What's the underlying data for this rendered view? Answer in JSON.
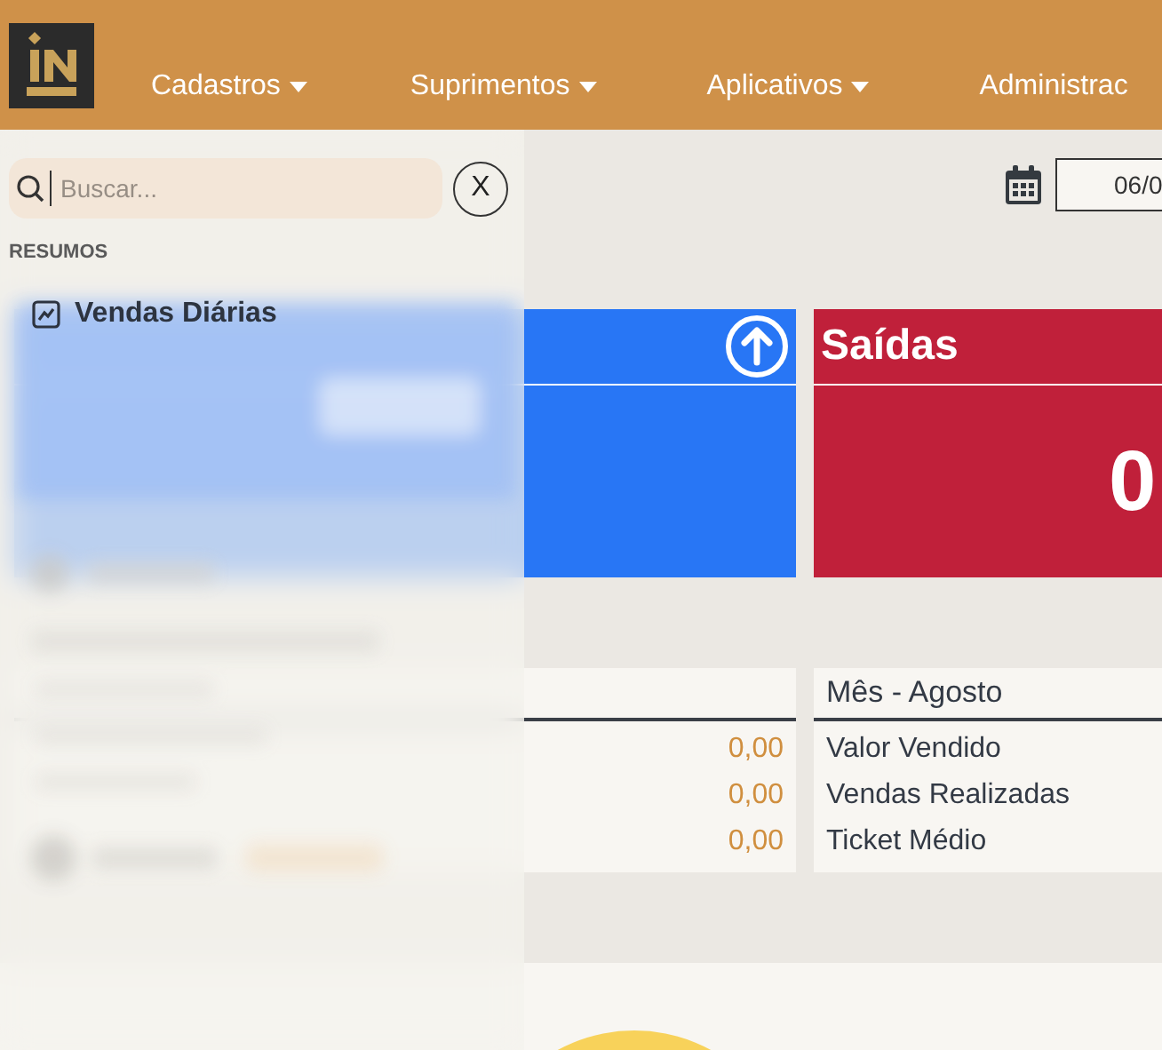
{
  "header": {
    "menu": [
      {
        "label": "Cadastros",
        "dropdown": true
      },
      {
        "label": "Suprimentos",
        "dropdown": true
      },
      {
        "label": "Aplicativos",
        "dropdown": true
      },
      {
        "label": "Administrac",
        "dropdown": false
      }
    ]
  },
  "date_field": {
    "value": "06/0"
  },
  "cards": [
    {
      "kind": "entradas"
    },
    {
      "kind": "saidas",
      "title": "Saídas",
      "value": "0"
    }
  ],
  "panels": [
    {
      "rows": [
        {
          "value": "0,00"
        },
        {
          "value": "0,00"
        },
        {
          "value": "0,00"
        }
      ]
    },
    {
      "title": "Mês - Agosto",
      "rows": [
        {
          "label": "Valor Vendido"
        },
        {
          "label": "Vendas Realizadas"
        },
        {
          "label": "Ticket Médio"
        }
      ]
    }
  ],
  "drawer": {
    "search": {
      "placeholder": "Buscar..."
    },
    "close_label": "X",
    "section": "RESUMOS",
    "items": [
      {
        "label": "Vendas Diárias"
      }
    ]
  }
}
